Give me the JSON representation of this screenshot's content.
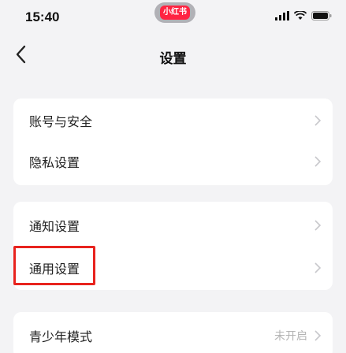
{
  "status_bar": {
    "time": "15:40",
    "app_badge": "小红书",
    "icons": [
      "signal-icon",
      "wifi-icon",
      "battery-icon"
    ]
  },
  "nav": {
    "back_icon": "chevron-left-icon",
    "title": "设置"
  },
  "groups": [
    {
      "items": [
        {
          "label": "账号与安全"
        },
        {
          "label": "隐私设置"
        }
      ]
    },
    {
      "items": [
        {
          "label": "通知设置"
        },
        {
          "label": "通用设置"
        }
      ]
    },
    {
      "items": [
        {
          "label": "青少年模式",
          "value": "未开启"
        }
      ]
    }
  ],
  "colors": {
    "background": "#f3f3f5",
    "card": "#ffffff",
    "highlight": "#e8231e",
    "brand": "#ff2442"
  }
}
